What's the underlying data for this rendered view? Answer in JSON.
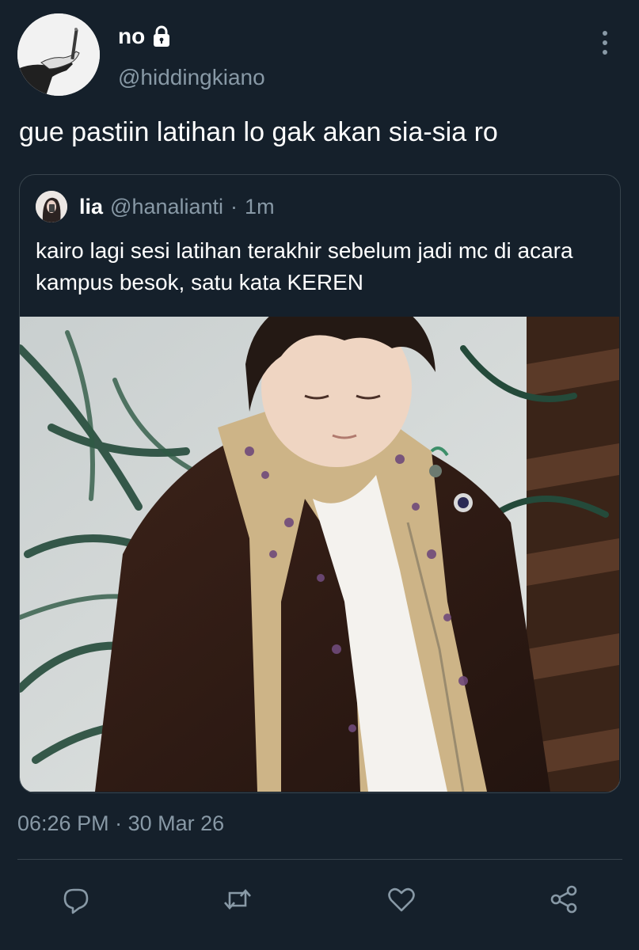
{
  "tweet": {
    "author": {
      "display_name": "no",
      "handle": "@hiddingkiano",
      "locked_icon": "lock-icon"
    },
    "text": "gue pastiin latihan lo gak akan sia-sia ro",
    "timestamp": {
      "time": "06:26 PM",
      "separator": "·",
      "date": "30 Mar 26"
    }
  },
  "quoted_tweet": {
    "display_name": "lia",
    "handle": "@hanalianti",
    "separator": "·",
    "time_ago": "1m",
    "text": "kairo lagi sesi latihan terakhir sebelum jadi mc di acara kampus besok, satu kata KEREN",
    "media": "photo"
  },
  "actions": [
    {
      "name": "reply-icon"
    },
    {
      "name": "retweet-icon"
    },
    {
      "name": "like-icon"
    },
    {
      "name": "share-icon"
    }
  ],
  "colors": {
    "background": "#15202b",
    "primary_text": "#ffffff",
    "secondary_text": "#8899a6",
    "border": "#38444d"
  }
}
